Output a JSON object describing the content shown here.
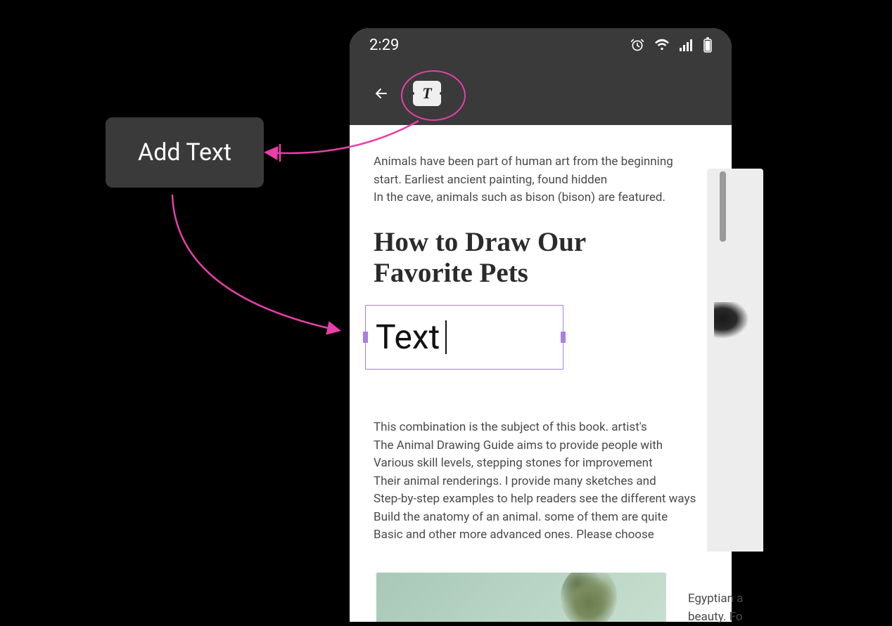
{
  "callout": {
    "label": "Add Text"
  },
  "statusbar": {
    "time": "2:29"
  },
  "toolbar": {
    "text_tool_glyph": "T"
  },
  "doc": {
    "para1_l1": "Animals have been part of human art from the beginning",
    "para1_l2": "start. Earliest ancient painting, found hidden",
    "para1_l3": "In the cave, animals such as bison (bison) are featured.",
    "heading_l1": "How to Draw Our",
    "heading_l2": "Favorite Pets",
    "textbox_value": "Text",
    "para2_l1": "This combination is the subject of this book. artist's",
    "para2_l2": "The Animal Drawing Guide aims to provide people with",
    "para2_l3": "Various skill levels, stepping stones for improvement",
    "para2_l4": "Their animal renderings. I provide many sketches and",
    "para2_l5": "Step-by-step examples to help readers see the different ways",
    "para2_l6": "Build the anatomy of an animal. some of them are quite",
    "para2_l7": "Basic and other more advanced ones. Please choose"
  },
  "side": {
    "line1": "Egyptian a",
    "line2": "beauty. Fo"
  },
  "colors": {
    "annotation": "#e83fa8",
    "selection": "#ab7ee0"
  }
}
